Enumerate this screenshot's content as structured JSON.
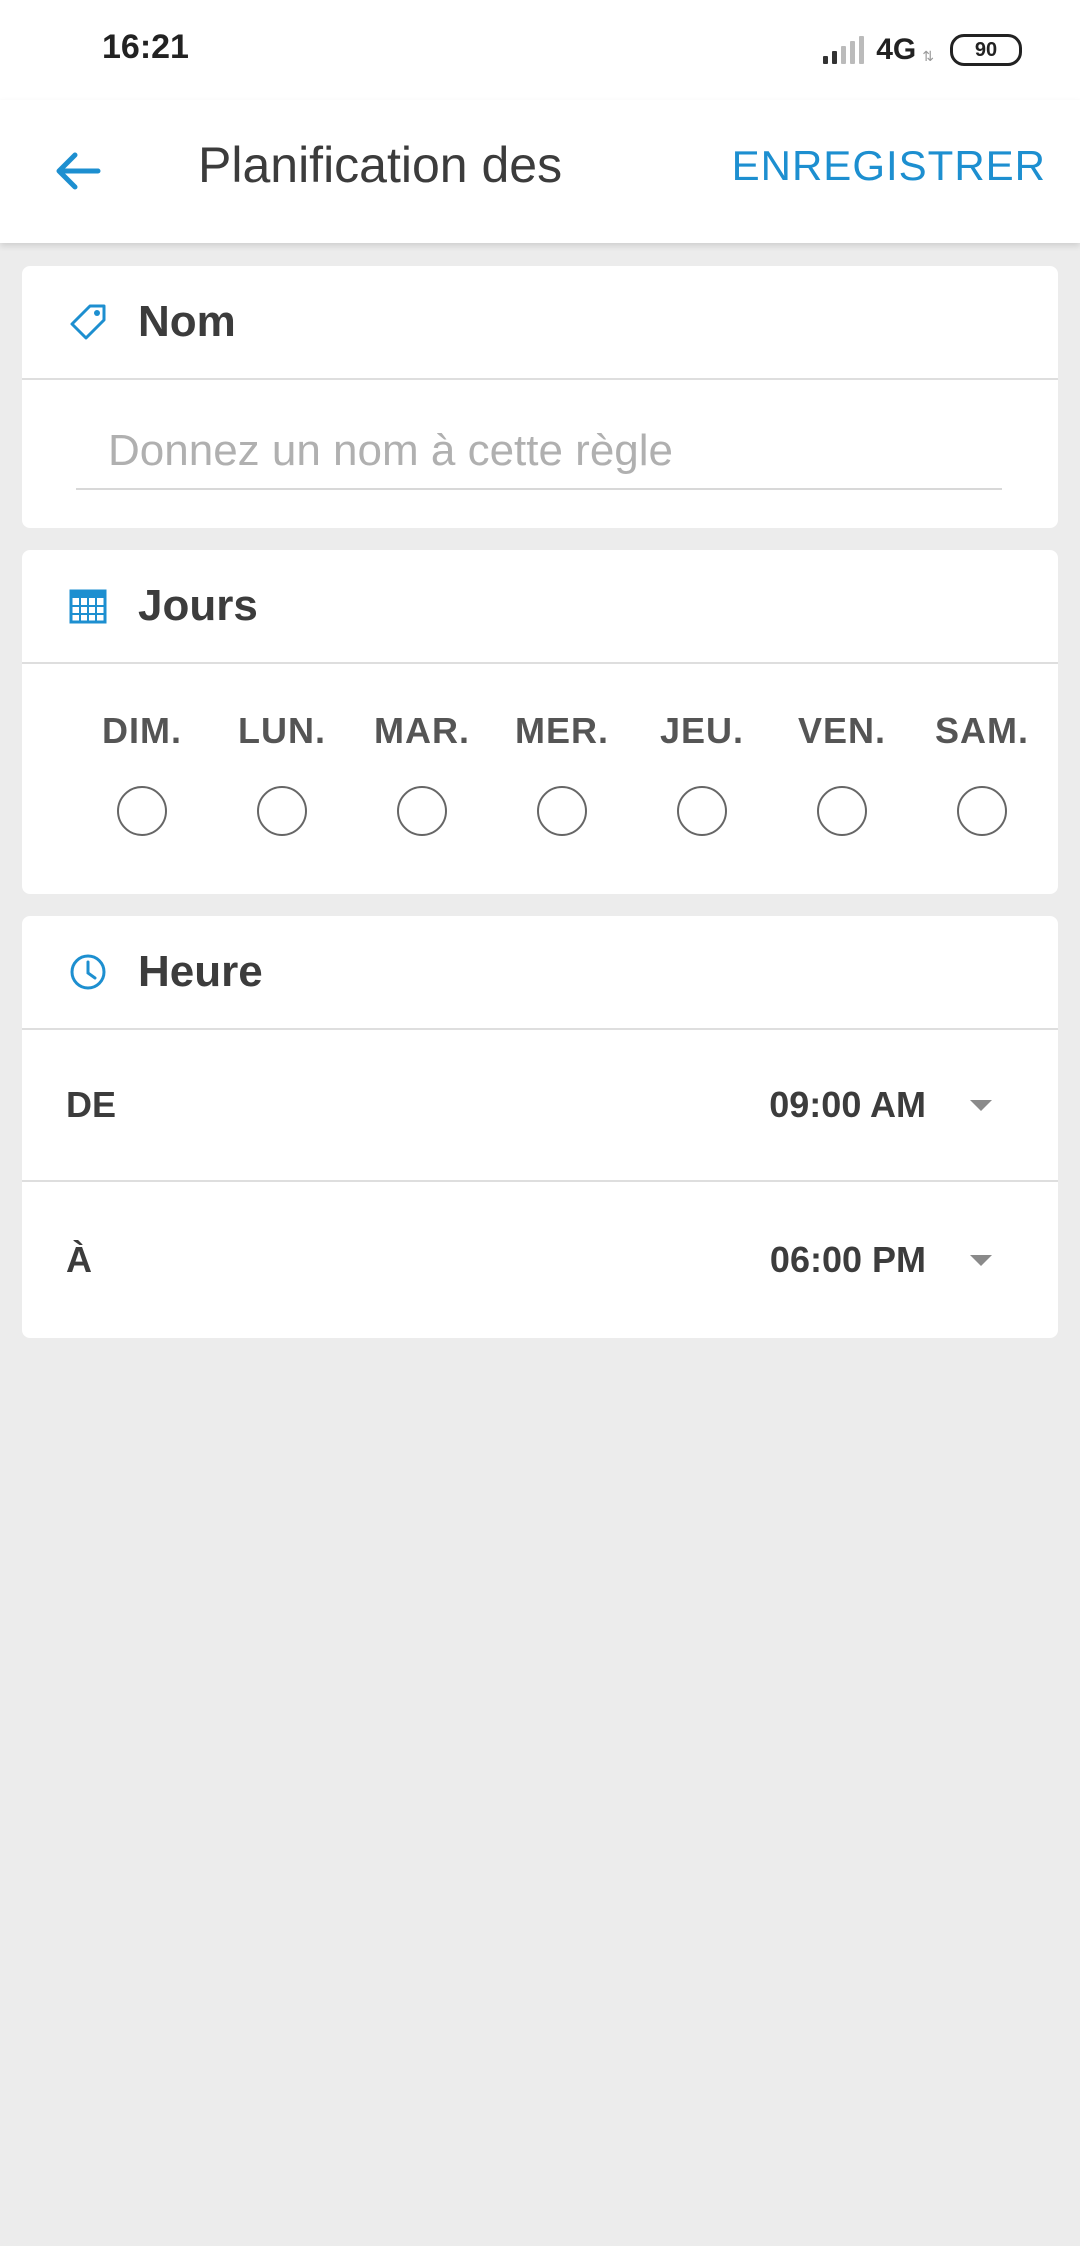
{
  "status_bar": {
    "time": "16:21",
    "network": "4G",
    "battery": "90"
  },
  "app_bar": {
    "back_icon": "arrow-left-icon",
    "title": "Planification des",
    "save_label": "ENREGISTRER",
    "accent_color": "#1d8fd0"
  },
  "name_section": {
    "icon": "tag-icon",
    "header": "Nom",
    "input_value": "",
    "input_placeholder": "Donnez un nom à cette règle"
  },
  "days_section": {
    "icon": "calendar-icon",
    "header": "Jours",
    "days": [
      {
        "label": "DIM.",
        "checked": false
      },
      {
        "label": "LUN.",
        "checked": false
      },
      {
        "label": "MAR.",
        "checked": false
      },
      {
        "label": "MER.",
        "checked": false
      },
      {
        "label": "JEU.",
        "checked": false
      },
      {
        "label": "VEN.",
        "checked": false
      },
      {
        "label": "SAM.",
        "checked": false
      }
    ]
  },
  "time_section": {
    "icon": "clock-icon",
    "header": "Heure",
    "from": {
      "label": "DE",
      "value": "09:00 AM"
    },
    "to": {
      "label": "À",
      "value": "06:00 PM"
    }
  }
}
